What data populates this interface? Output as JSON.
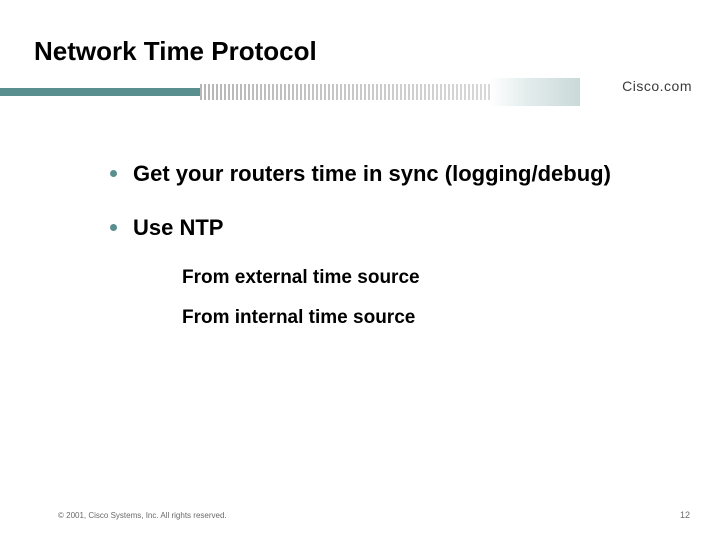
{
  "title": "Network Time Protocol",
  "brand": "Cisco.com",
  "bullets": [
    {
      "text": "Get your routers time in sync (logging/debug)"
    },
    {
      "text": "Use NTP"
    }
  ],
  "sub_bullets": [
    {
      "text": "From external time source"
    },
    {
      "text": "From internal time source"
    }
  ],
  "footer": {
    "copyright": "© 2001, Cisco Systems, Inc. All rights reserved.",
    "page": "12"
  }
}
